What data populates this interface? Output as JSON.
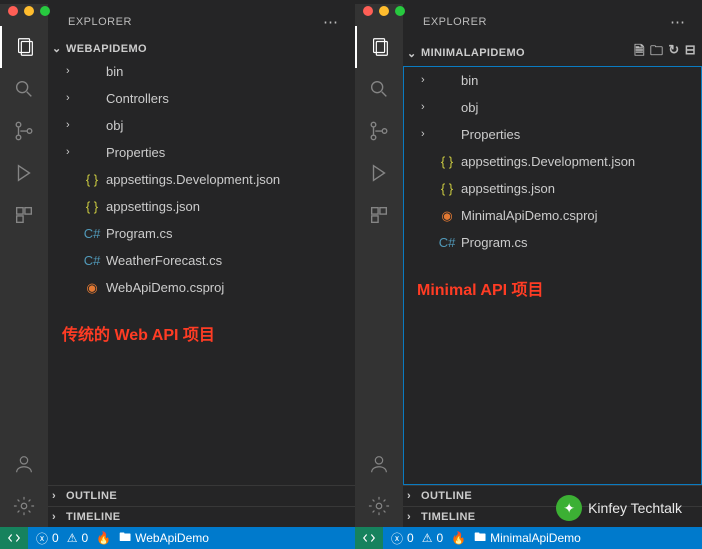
{
  "left": {
    "explorer_title": "EXPLORER",
    "project": "WEBAPIDEMO",
    "items": [
      {
        "kind": "folder",
        "label": "bin"
      },
      {
        "kind": "folder",
        "label": "Controllers"
      },
      {
        "kind": "folder",
        "label": "obj"
      },
      {
        "kind": "folder",
        "label": "Properties"
      },
      {
        "kind": "json",
        "label": "appsettings.Development.json",
        "color": "#cbcb41"
      },
      {
        "kind": "json",
        "label": "appsettings.json",
        "color": "#cbcb41"
      },
      {
        "kind": "cs",
        "label": "Program.cs",
        "color": "#519aba"
      },
      {
        "kind": "cs",
        "label": "WeatherForecast.cs",
        "color": "#519aba"
      },
      {
        "kind": "proj",
        "label": "WebApiDemo.csproj",
        "color": "#e37933"
      }
    ],
    "overlay": "传统的 Web API 项目",
    "outline": "OUTLINE",
    "timeline": "TIMELINE",
    "status": {
      "errors": "0",
      "warnings": "0",
      "project": "WebApiDemo"
    }
  },
  "right": {
    "explorer_title": "EXPLORER",
    "project": "MINIMALAPIDEMO",
    "items": [
      {
        "kind": "folder",
        "label": "bin"
      },
      {
        "kind": "folder",
        "label": "obj"
      },
      {
        "kind": "folder",
        "label": "Properties"
      },
      {
        "kind": "json",
        "label": "appsettings.Development.json",
        "color": "#cbcb41"
      },
      {
        "kind": "json",
        "label": "appsettings.json",
        "color": "#cbcb41"
      },
      {
        "kind": "proj",
        "label": "MinimalApiDemo.csproj",
        "color": "#e37933"
      },
      {
        "kind": "cs",
        "label": "Program.cs",
        "color": "#519aba"
      }
    ],
    "overlay": "Minimal  API 项目",
    "outline": "OUTLINE",
    "timeline": "TIMELINE",
    "status": {
      "errors": "0",
      "warnings": "0",
      "project": "MinimalApiDemo"
    }
  },
  "watermark": "Kinfey Techtalk"
}
